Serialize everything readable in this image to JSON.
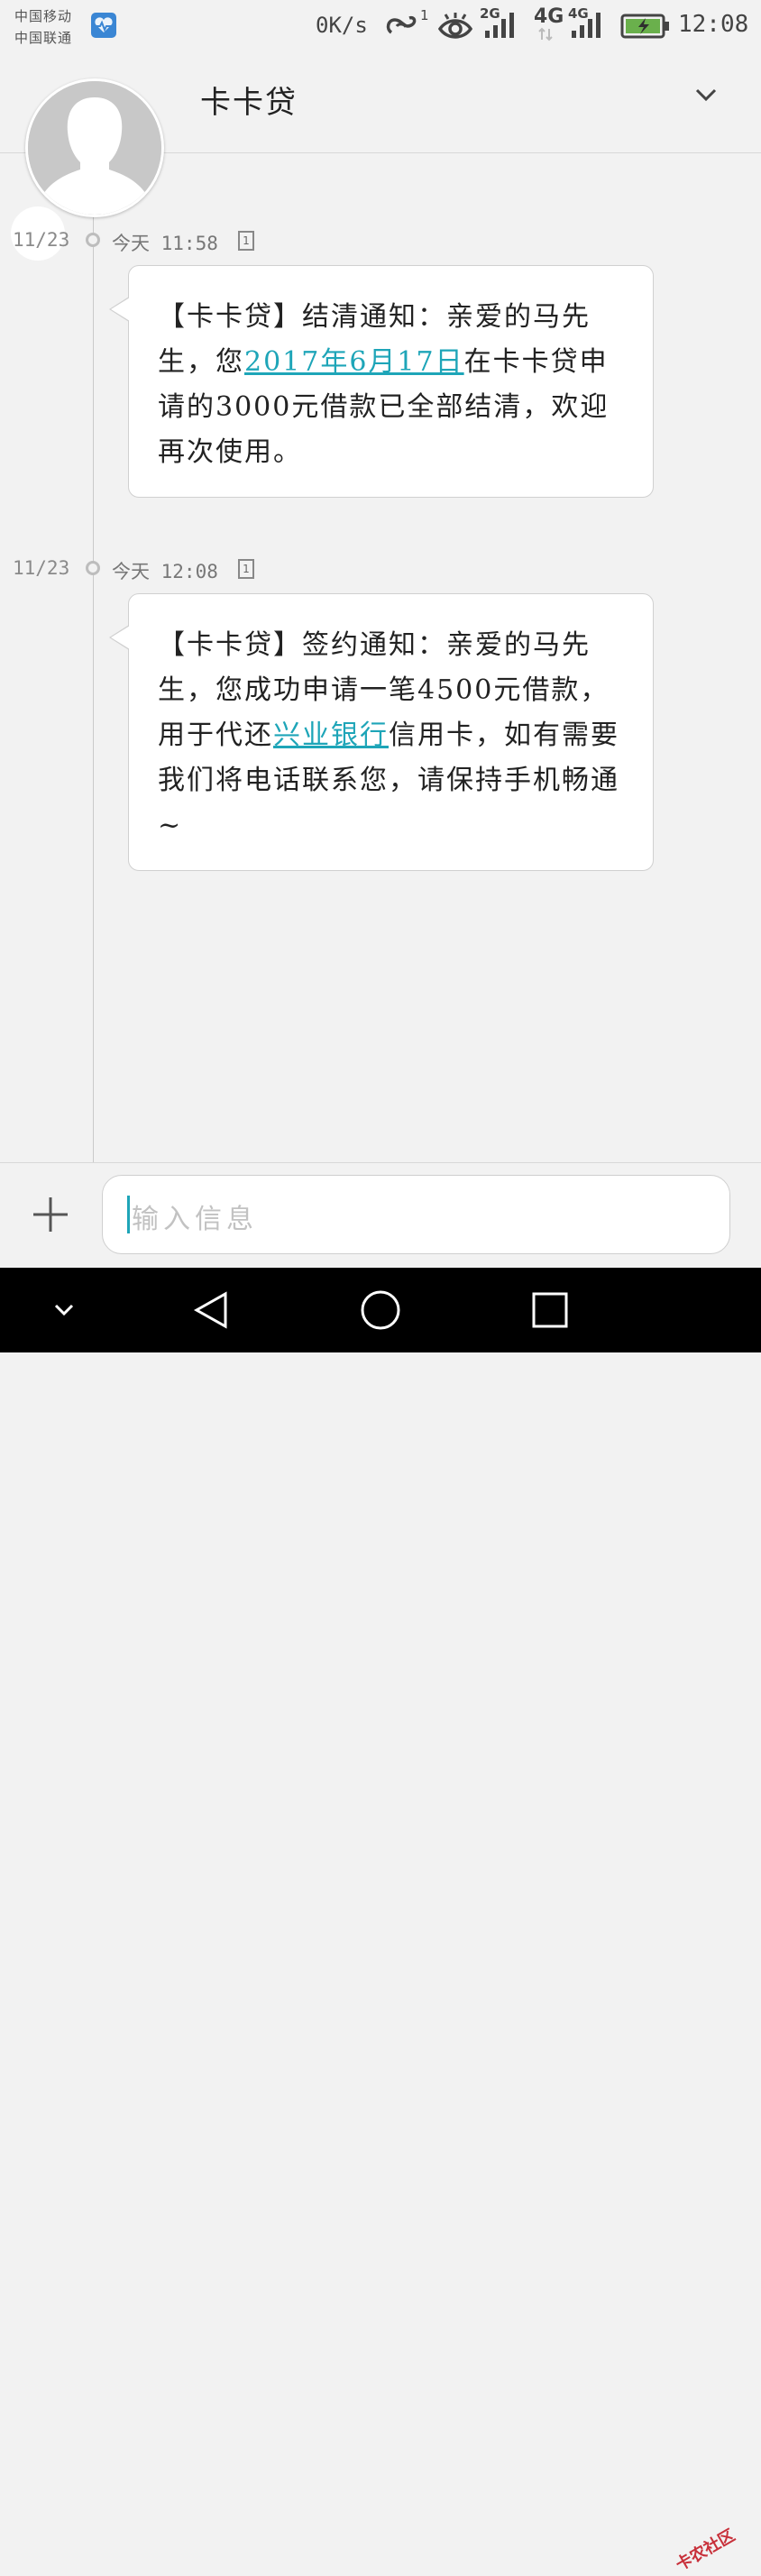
{
  "status_bar": {
    "carrier_1": "中国移动",
    "carrier_2": "中国联通",
    "net_speed": "0K/s",
    "hd_sup": "1",
    "sim1_type": "2G",
    "sim2_type": "4G",
    "sim2_sub": "4G",
    "time": "12:08",
    "icons": [
      "health-app-icon",
      "hd-call-icon",
      "eye-comfort-icon",
      "signal-icon",
      "signal-icon",
      "battery-charging-icon"
    ]
  },
  "header": {
    "contact_name": "卡卡贷",
    "icons": [
      "avatar-placeholder",
      "chevron-down-icon"
    ]
  },
  "messages": [
    {
      "date": "11/23",
      "time": "今天 11:58",
      "sim": "1",
      "text_before": "【卡卡贷】结清通知：亲爱的马先生，您",
      "link": "2017年6月17日",
      "text_after": "在卡卡贷申请的3000元借款已全部结清，欢迎再次使用。"
    },
    {
      "date": "11/23",
      "time": "今天 12:08",
      "sim": "1",
      "text_before": "【卡卡贷】签约通知：亲爱的马先生，您成功申请一笔4500元借款，用于代还",
      "link": "兴业银行",
      "text_after": "信用卡，如有需要我们将电话联系您，请保持手机畅通~"
    }
  ],
  "compose": {
    "placeholder": "输入信息",
    "icons": [
      "plus-icon"
    ]
  },
  "nav_bar": {
    "icons": [
      "hide-nav-icon",
      "back-icon",
      "home-icon",
      "recents-icon"
    ],
    "watermark": "卡农社区"
  },
  "colors": {
    "link": "#1ea5b8",
    "background": "#f2f2f2",
    "bubble": "#ffffff",
    "nav": "#000000"
  }
}
